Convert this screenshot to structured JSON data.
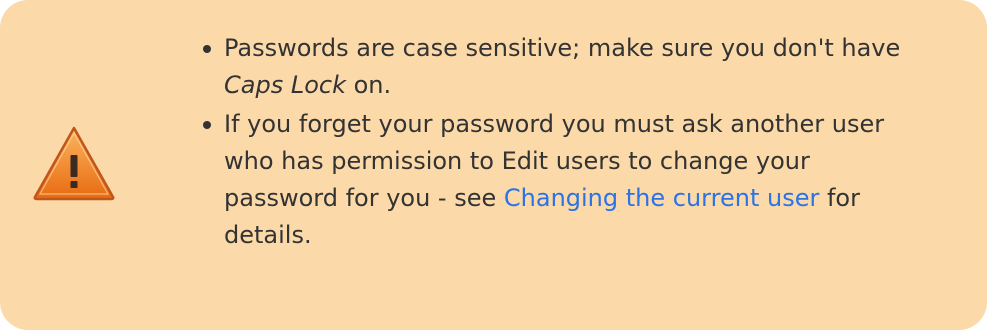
{
  "icon": {
    "name": "warning-icon",
    "colors": {
      "fill_light": "#fbae55",
      "fill_dark": "#e86a10",
      "stroke": "#c1561a",
      "mark": "#3a2a22"
    },
    "mark": "!"
  },
  "notes": [
    {
      "before": "Passwords are case sensitive; make sure you don't have ",
      "emphasis": "Caps Lock",
      "after": " on."
    },
    {
      "before": "If you forget your password you must ask another user who has permission to Edit users to change your password for you - see ",
      "link": "Changing the current user",
      "after": " for details."
    }
  ],
  "colors": {
    "background": "#fbd9a8",
    "text": "#333333",
    "link": "#2b73e6"
  }
}
